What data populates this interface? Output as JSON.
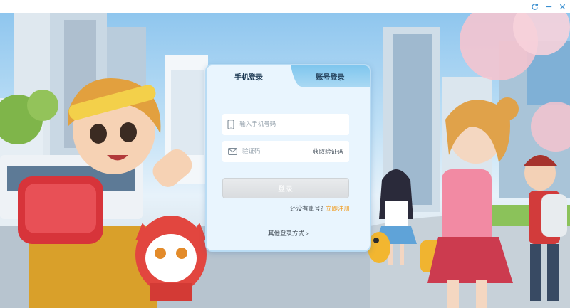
{
  "window": {
    "controls": [
      "refresh-icon",
      "minimize-icon",
      "close-icon"
    ]
  },
  "login": {
    "tab_phone": "手机登录",
    "tab_account": "账号登录",
    "phone_placeholder": "输入手机号码",
    "code_placeholder": "验证码",
    "get_code": "获取验证码",
    "login_button": "登录",
    "no_account": "还没有账号?",
    "register": "立即注册",
    "other_methods": "其他登录方式 ›"
  },
  "colors": {
    "accent": "#f19a1a",
    "panel": "#e9f5fe",
    "tab_inactive": "#8fcff0"
  }
}
